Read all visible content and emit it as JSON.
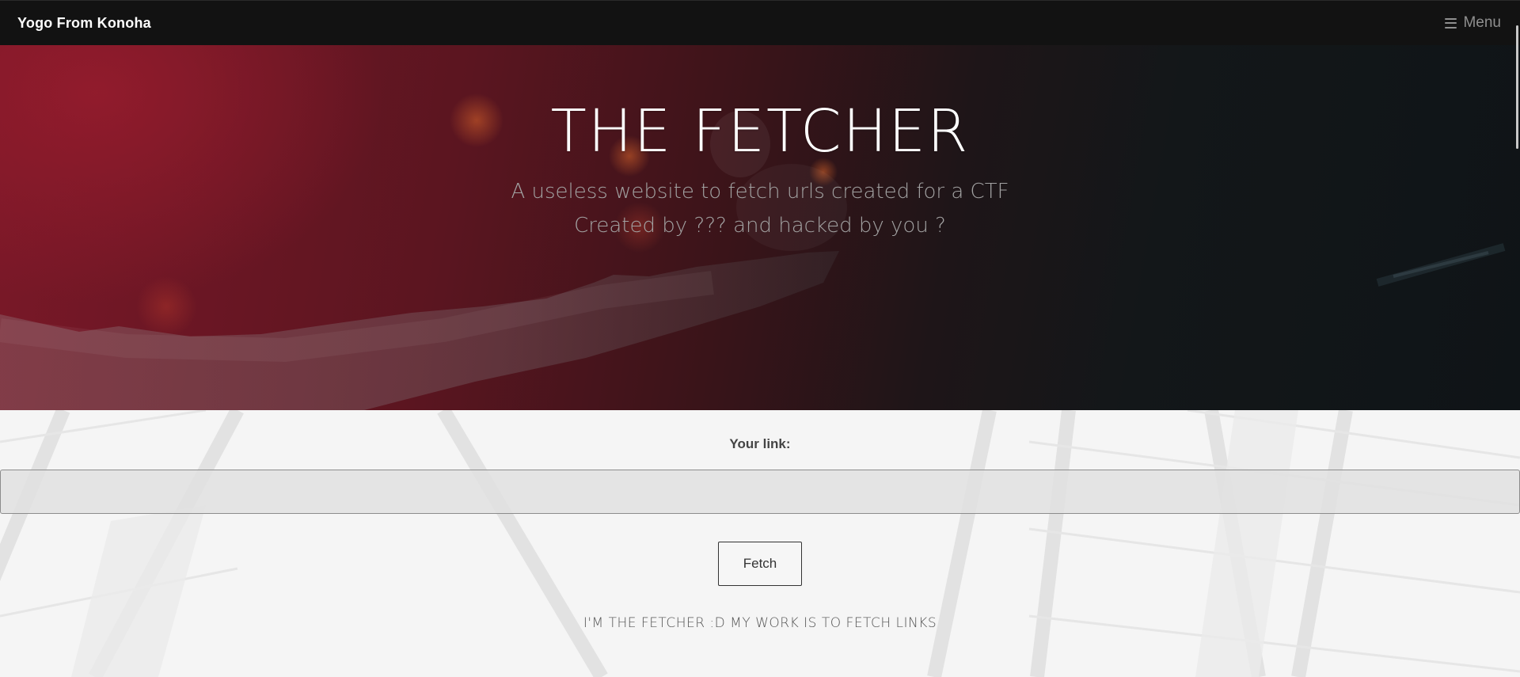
{
  "navbar": {
    "brand": "Yogo From Konoha",
    "menu_label": "Menu",
    "menu_icon": "hamburger-icon"
  },
  "hero": {
    "title": "THE FETCHER",
    "subtitle_line1": "A useless website to fetch urls created for a CTF",
    "subtitle_line2": "Created by ??? and hacked by you ?"
  },
  "form": {
    "label": "Your link:",
    "input_value": "",
    "input_placeholder": "",
    "button_label": "Fetch"
  },
  "tagline": "I'M THE FETCHER :D MY WORK IS TO FETCH LINKS",
  "colors": {
    "navbar_bg": "#121212",
    "hero_accent": "#7b1828",
    "hero_dark": "#0f1417",
    "section_bg": "#f5f5f5"
  }
}
